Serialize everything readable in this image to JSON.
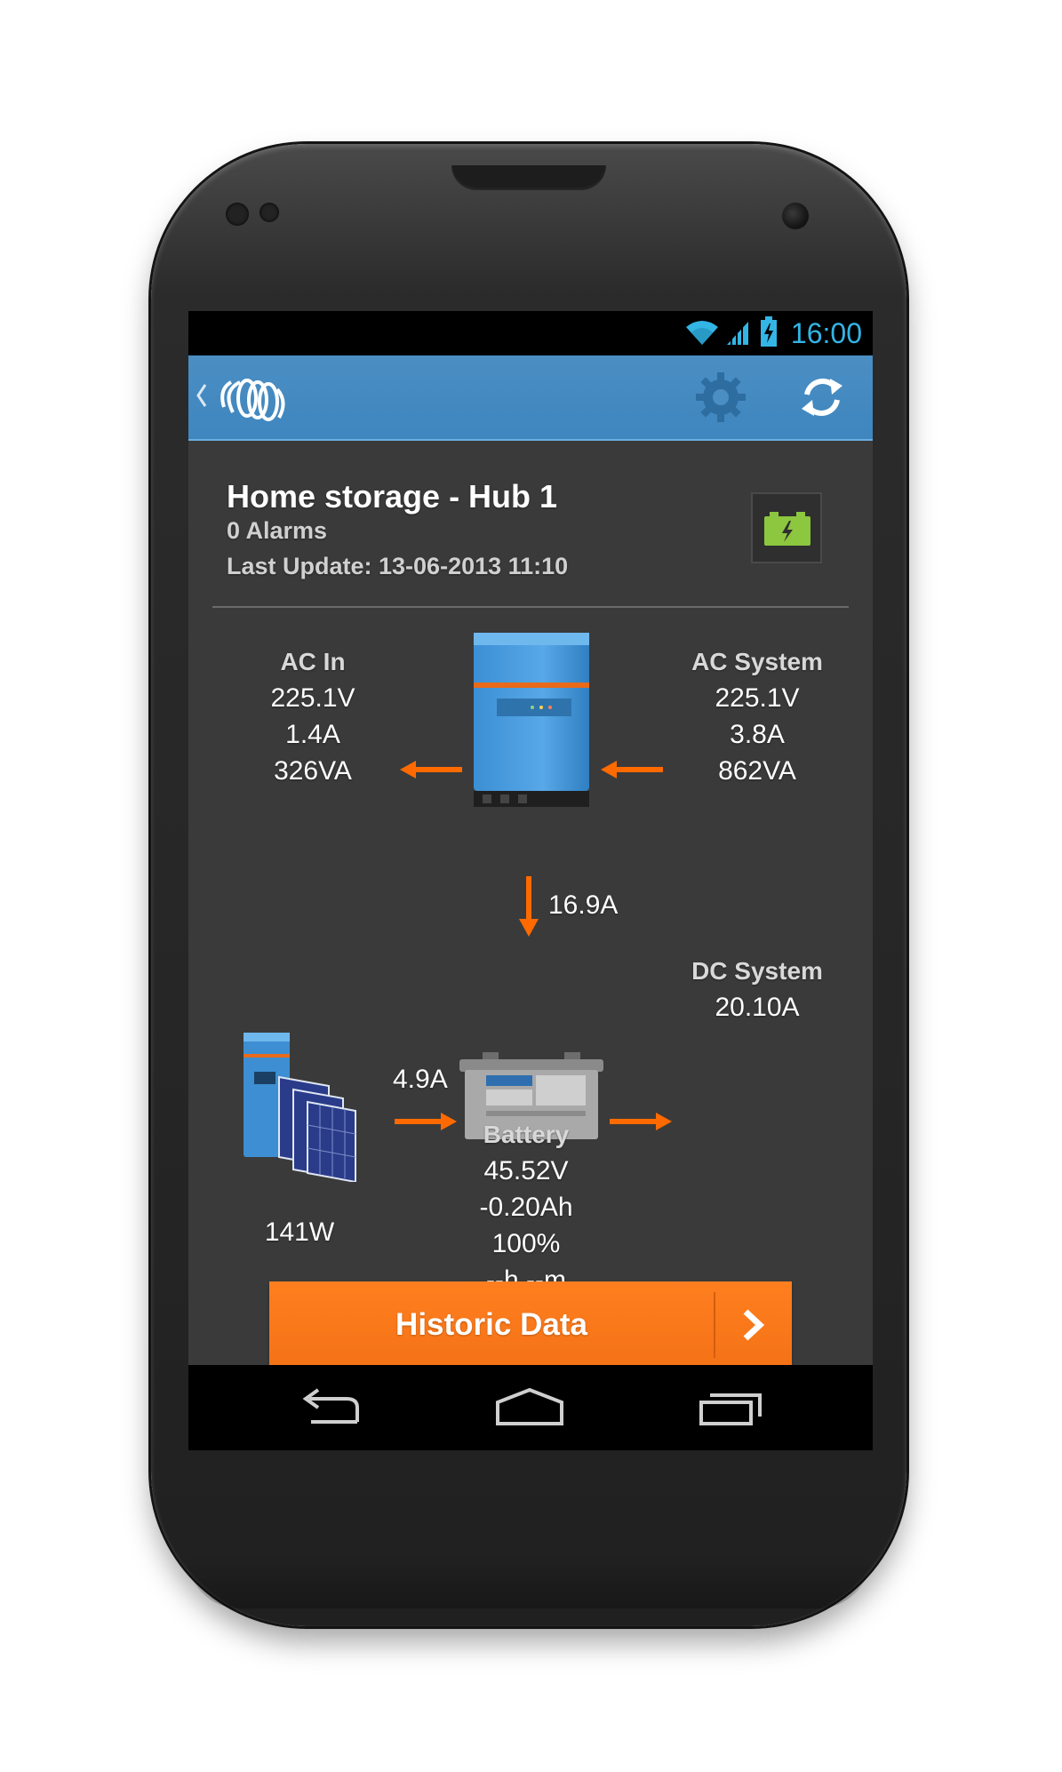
{
  "status_bar": {
    "time": "16:00",
    "wifi_icon": "wifi-icon",
    "signal_icon": "signal-icon",
    "battery_icon": "battery-charging-icon",
    "accent": "#33b5e5"
  },
  "action_bar": {
    "back_icon": "chevron-left-icon",
    "logo": "victron-logo",
    "settings_icon": "gear-icon",
    "refresh_icon": "refresh-icon",
    "color": "#4a8ec3"
  },
  "site": {
    "title": "Home storage - Hub 1",
    "alarms": "0 Alarms",
    "last_update": "Last Update: 13-06-2013 11:10",
    "status_icon": "battery-charging-icon",
    "status_color": "#8dc63f"
  },
  "ac_in": {
    "label": "AC In",
    "voltage": "225.1V",
    "current": "1.4A",
    "power": "326VA"
  },
  "ac_system": {
    "label": "AC System",
    "voltage": "225.1V",
    "current": "3.8A",
    "power": "862VA"
  },
  "inverter": {
    "dc_current": "16.9A",
    "image": "multiplus-inverter"
  },
  "solar": {
    "power": "141W",
    "current": "4.9A",
    "image": "solar-charger-with-panels"
  },
  "dc_system": {
    "label": "DC System",
    "current": "20.10A"
  },
  "battery": {
    "label": "Battery",
    "voltage": "45.52V",
    "consumed": "-0.20Ah",
    "soc": "100%",
    "time_to_go": "--h --m",
    "image": "battery"
  },
  "historic_button": {
    "label": "Historic Data",
    "icon": "chevron-right-icon",
    "color": "#ff7f1f"
  },
  "nav_bar": {
    "back_icon": "back-icon",
    "home_icon": "home-icon",
    "recent_icon": "recent-apps-icon"
  },
  "arrow_color": "#ff6a00"
}
